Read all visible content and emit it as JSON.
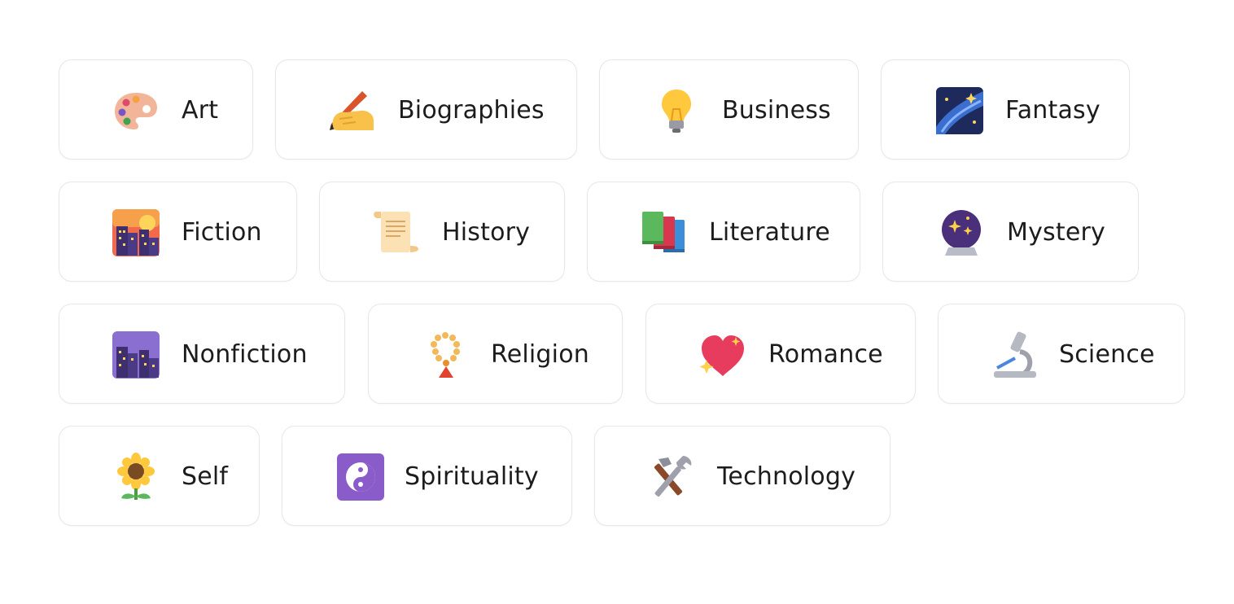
{
  "categories": [
    {
      "label": "Art",
      "icon": "artist-palette-icon"
    },
    {
      "label": "Biographies",
      "icon": "writing-hand-icon"
    },
    {
      "label": "Business",
      "icon": "light-bulb-icon"
    },
    {
      "label": "Fantasy",
      "icon": "milky-way-icon"
    },
    {
      "label": "Fiction",
      "icon": "cityscape-at-dusk-icon"
    },
    {
      "label": "History",
      "icon": "scroll-icon"
    },
    {
      "label": "Literature",
      "icon": "books-icon"
    },
    {
      "label": "Mystery",
      "icon": "crystal-ball-icon"
    },
    {
      "label": "Nonfiction",
      "icon": "night-with-stars-icon"
    },
    {
      "label": "Religion",
      "icon": "prayer-beads-icon"
    },
    {
      "label": "Romance",
      "icon": "sparkling-heart-icon"
    },
    {
      "label": "Science",
      "icon": "microscope-icon"
    },
    {
      "label": "Self",
      "icon": "sunflower-icon"
    },
    {
      "label": "Spirituality",
      "icon": "yin-yang-icon"
    },
    {
      "label": "Technology",
      "icon": "hammer-and-wrench-icon"
    }
  ]
}
